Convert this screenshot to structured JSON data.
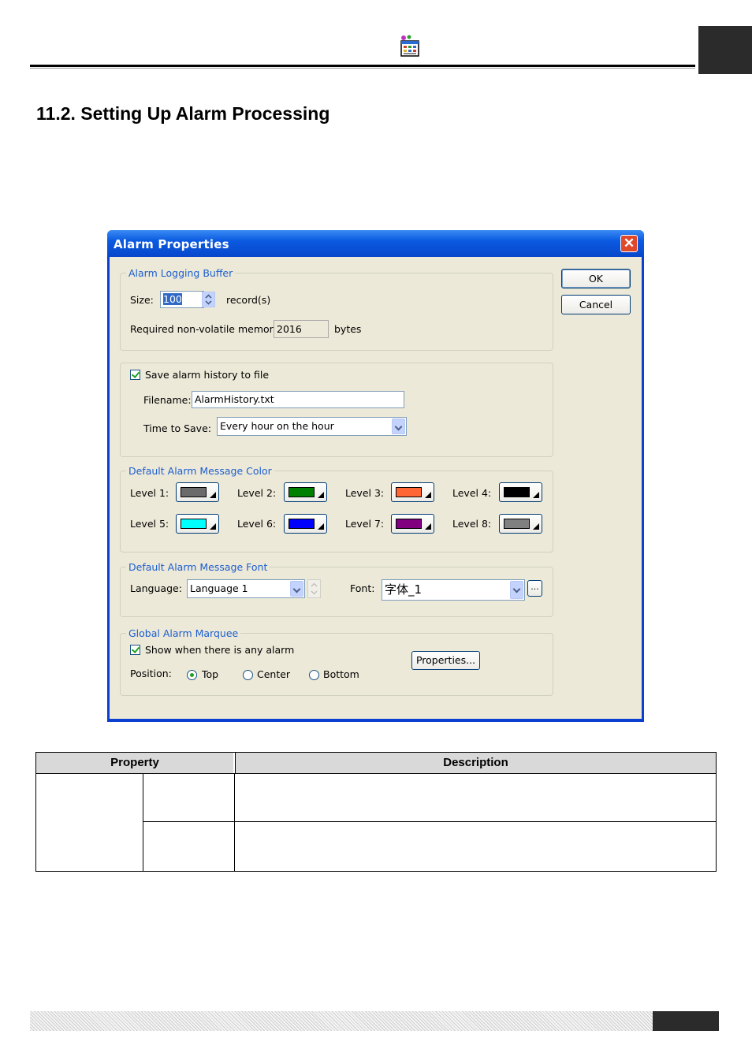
{
  "page": {
    "section_title": "11.2.  Setting Up Alarm Processing"
  },
  "dialog": {
    "title": "Alarm Properties",
    "ok_label": "OK",
    "cancel_label": "Cancel",
    "logging_buffer": {
      "legend": "Alarm Logging Buffer",
      "size_label": "Size:",
      "size_value": "100",
      "size_unit": "record(s)",
      "memory_label": "Required non-volatile memory:",
      "memory_value": "2016",
      "memory_unit": "bytes"
    },
    "history": {
      "save_label": "Save alarm history to file",
      "save_checked": true,
      "filename_label": "Filename:",
      "filename_value": "AlarmHistory.txt",
      "time_label": "Time to Save:",
      "time_value": "Every hour on the hour"
    },
    "color_group": {
      "legend": "Default Alarm Message Color",
      "levels": [
        {
          "label": "Level 1:",
          "color": "#6b6b6b"
        },
        {
          "label": "Level 2:",
          "color": "#008000"
        },
        {
          "label": "Level 3:",
          "color": "#ff6633"
        },
        {
          "label": "Level 4:",
          "color": "#000000"
        },
        {
          "label": "Level 5:",
          "color": "#00ffff"
        },
        {
          "label": "Level 6:",
          "color": "#0000ff"
        },
        {
          "label": "Level 7:",
          "color": "#800080"
        },
        {
          "label": "Level 8:",
          "color": "#808080"
        }
      ]
    },
    "font_group": {
      "legend": "Default Alarm Message Font",
      "language_label": "Language:",
      "language_value": "Language 1",
      "font_label": "Font:",
      "font_value": "字体_1",
      "browse_label": "..."
    },
    "marquee": {
      "legend": "Global Alarm Marquee",
      "show_label": "Show when there is any alarm",
      "show_checked": true,
      "properties_label": "Properties...",
      "position_label": "Position:",
      "options": [
        "Top",
        "Center",
        "Bottom"
      ],
      "selected": "Top"
    }
  },
  "table": {
    "headers": [
      "Property",
      "Description"
    ]
  },
  "icons": {
    "header": "window-grid-icon",
    "close": "close-icon",
    "dropdown": "chevron-down-icon"
  }
}
